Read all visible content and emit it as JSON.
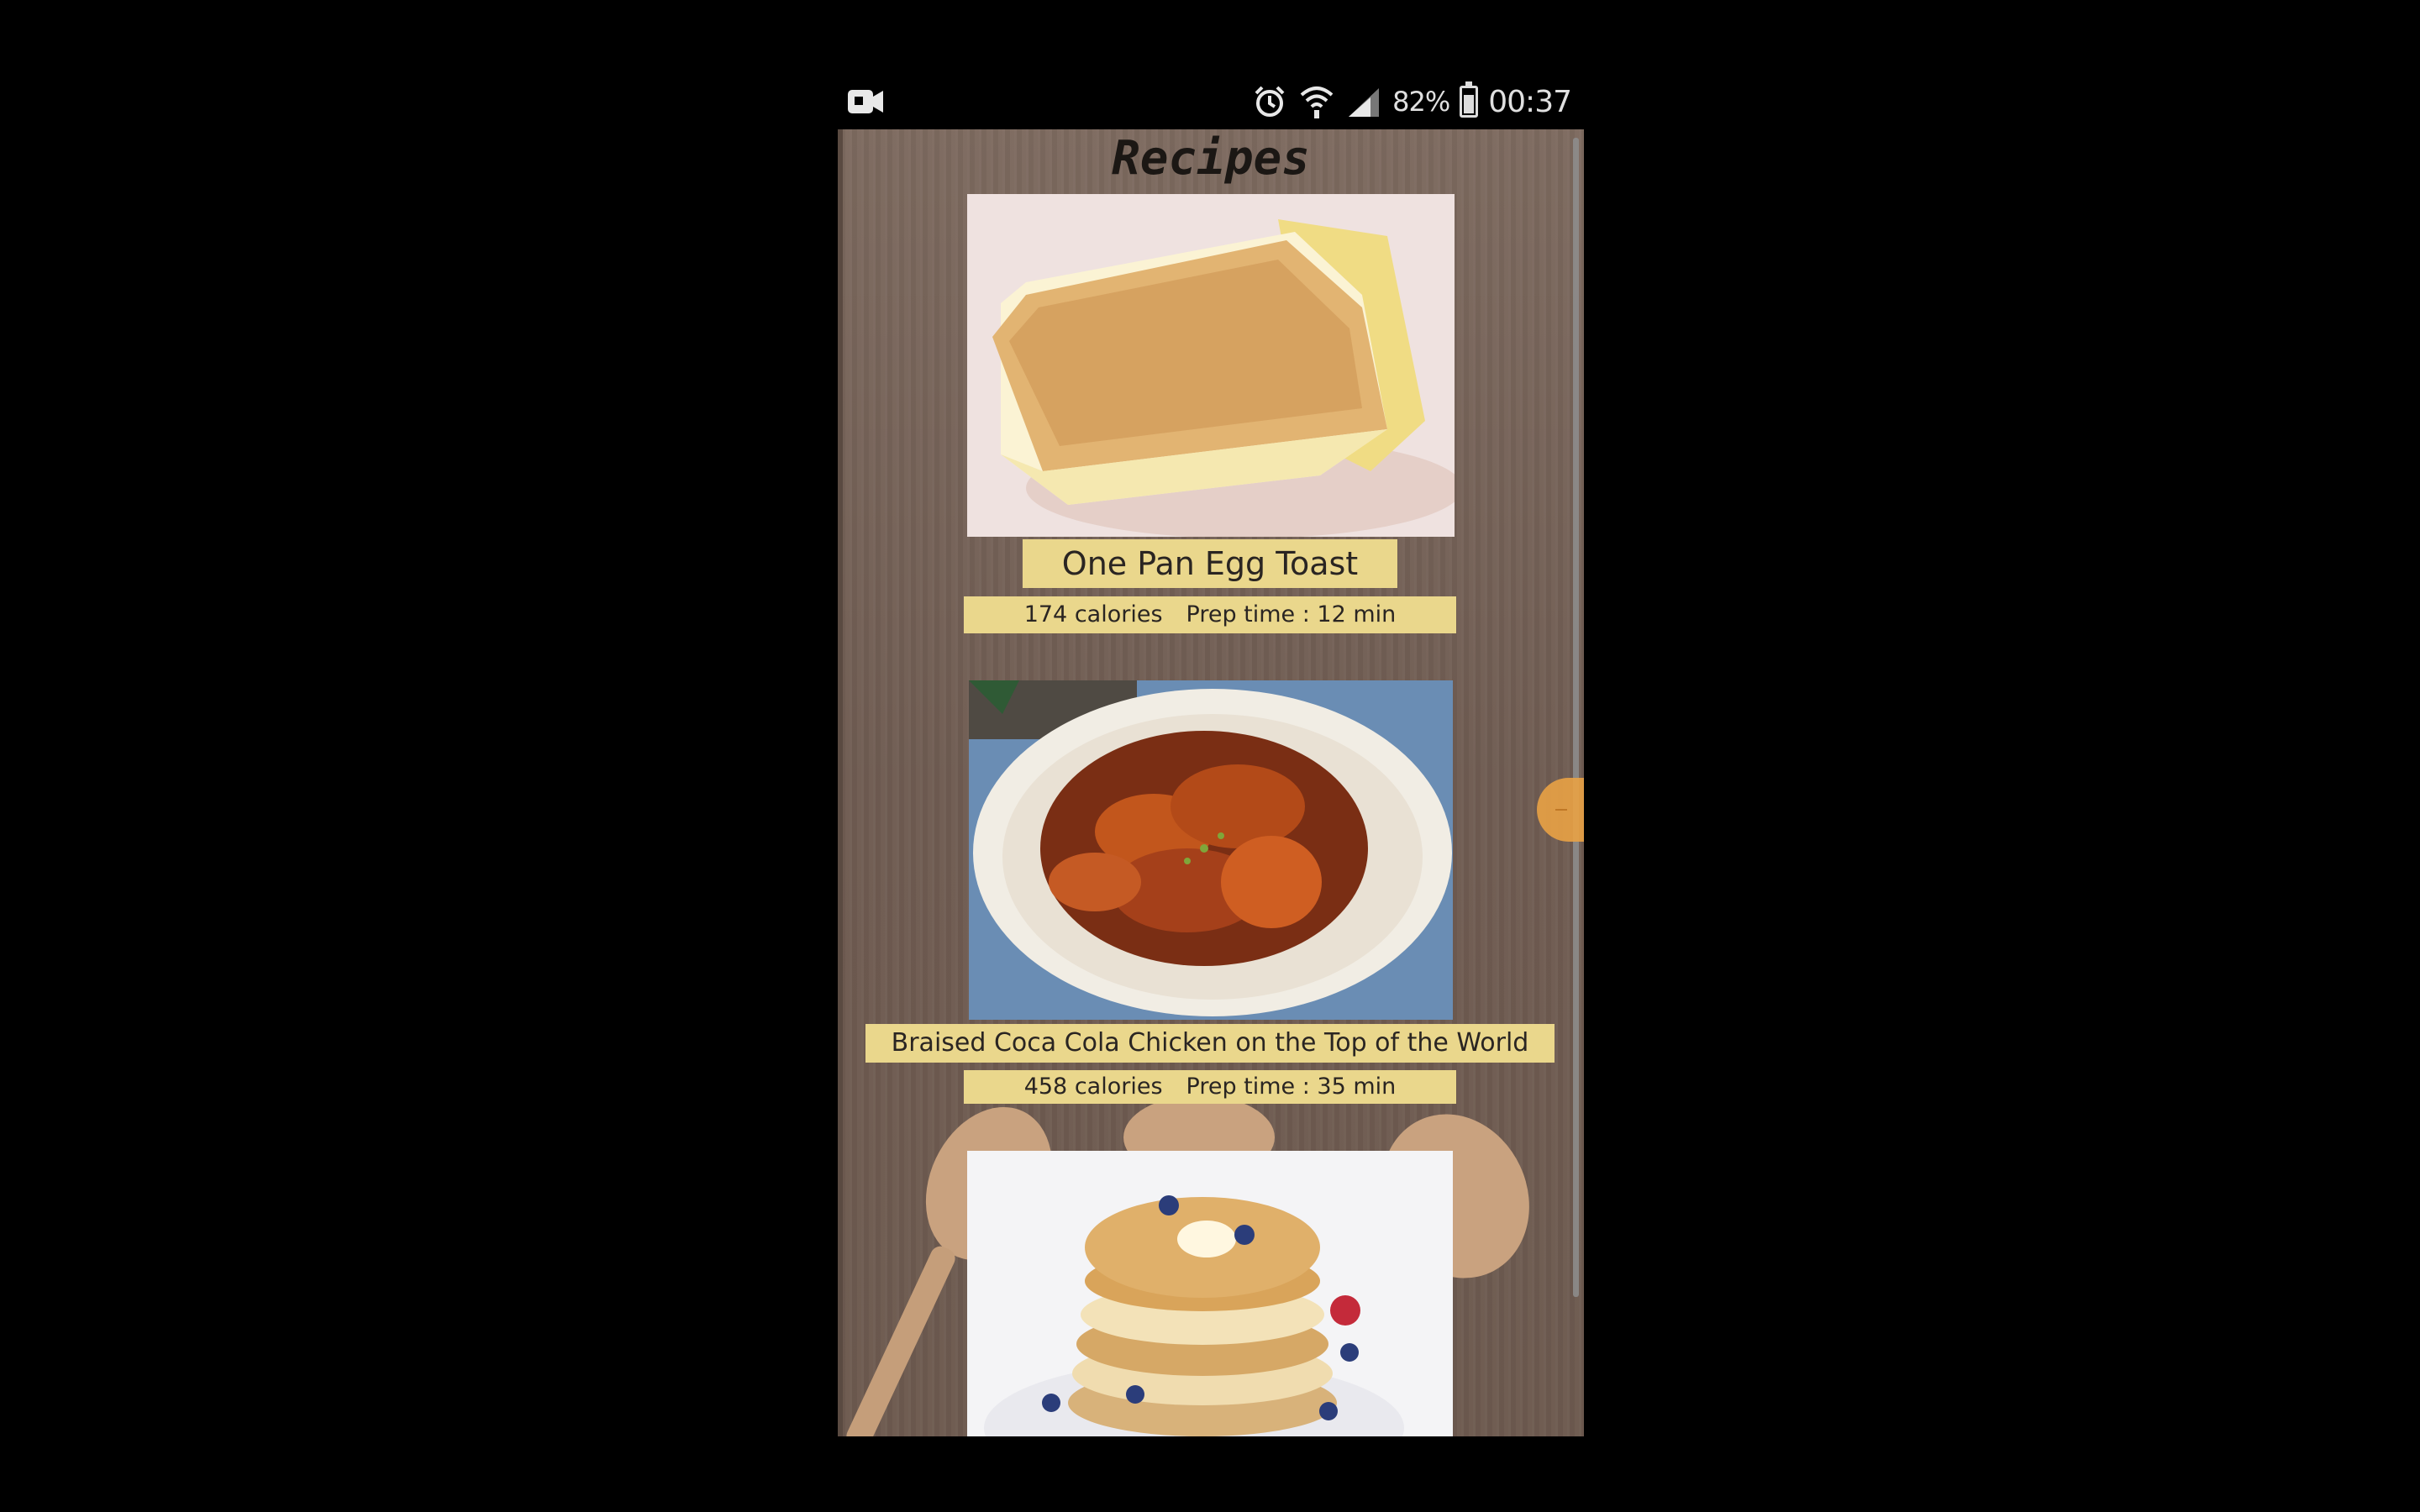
{
  "status_bar": {
    "icons": [
      "video-camera-icon",
      "alarm-icon",
      "wifi-icon",
      "signal-icon",
      "battery-icon"
    ],
    "battery_text": "82%",
    "battery_level": 0.82,
    "time": "00:37"
  },
  "app": {
    "title": "Recipes",
    "recipes": [
      {
        "name": "One Pan Egg Toast",
        "calories": "174 calories",
        "prep": "Prep time : 12 min",
        "image": "egg-toast-photo"
      },
      {
        "name": "Braised Coca Cola Chicken on the Top of the World",
        "calories": "458 calories",
        "prep": "Prep time : 35 min",
        "image": "coca-cola-chicken-photo"
      },
      {
        "name": "",
        "image": "pancakes-photo"
      }
    ]
  },
  "colors": {
    "background": "#000000",
    "wood": "#75625a",
    "label": "#ead78c",
    "fab": "#e9a245"
  }
}
